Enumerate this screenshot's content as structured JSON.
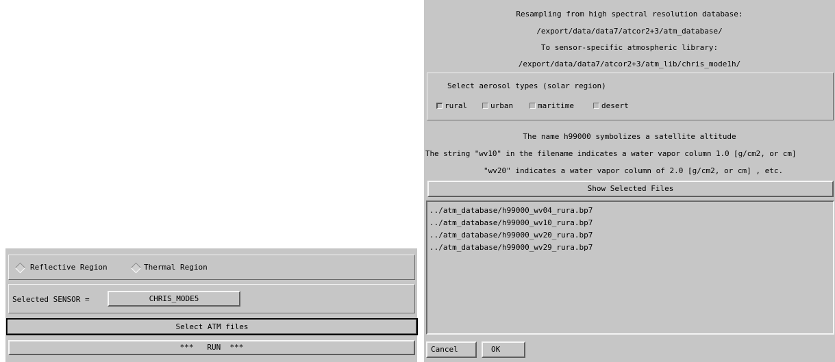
{
  "left_panel": {
    "region_options": [
      {
        "label": "Reflective Region",
        "selected": true
      },
      {
        "label": "Thermal Region",
        "selected": false
      }
    ],
    "sensor_label": "Selected SENSOR =",
    "sensor_value": "CHRIS_MODE5",
    "select_atm_button": "Select ATM files",
    "run_button": "***   RUN  ***"
  },
  "right_panel": {
    "header_lines": [
      "Resampling from high spectral resolution database:",
      "/export/data/data7/atcor2+3/atm_database/",
      "To sensor-specific atmospheric library:",
      "/export/data/data7/atcor2+3/atm_lib/chris_mode1h/"
    ],
    "aerosol_title": "Select aerosol types (solar region)",
    "aerosol_types": [
      {
        "label": "rural",
        "checked": true
      },
      {
        "label": "urban",
        "checked": false
      },
      {
        "label": "maritime",
        "checked": false
      },
      {
        "label": "desert",
        "checked": false
      }
    ],
    "info_lines": [
      "The name h99000 symbolizes a satellite altitude",
      "The string \"wv10\" in the filename indicates a water vapor column 1.0 [g/cm2, or cm]",
      "\"wv20\" indicates a water vapor column of 2.0 [g/cm2, or cm] , etc."
    ],
    "show_files_button": "Show Selected Files",
    "files": [
      "../atm_database/h99000_wv04_rura.bp7",
      "../atm_database/h99000_wv10_rura.bp7",
      "../atm_database/h99000_wv20_rura.bp7",
      "../atm_database/h99000_wv29_rura.bp7"
    ],
    "cancel_button": "Cancel",
    "ok_button": "OK"
  }
}
